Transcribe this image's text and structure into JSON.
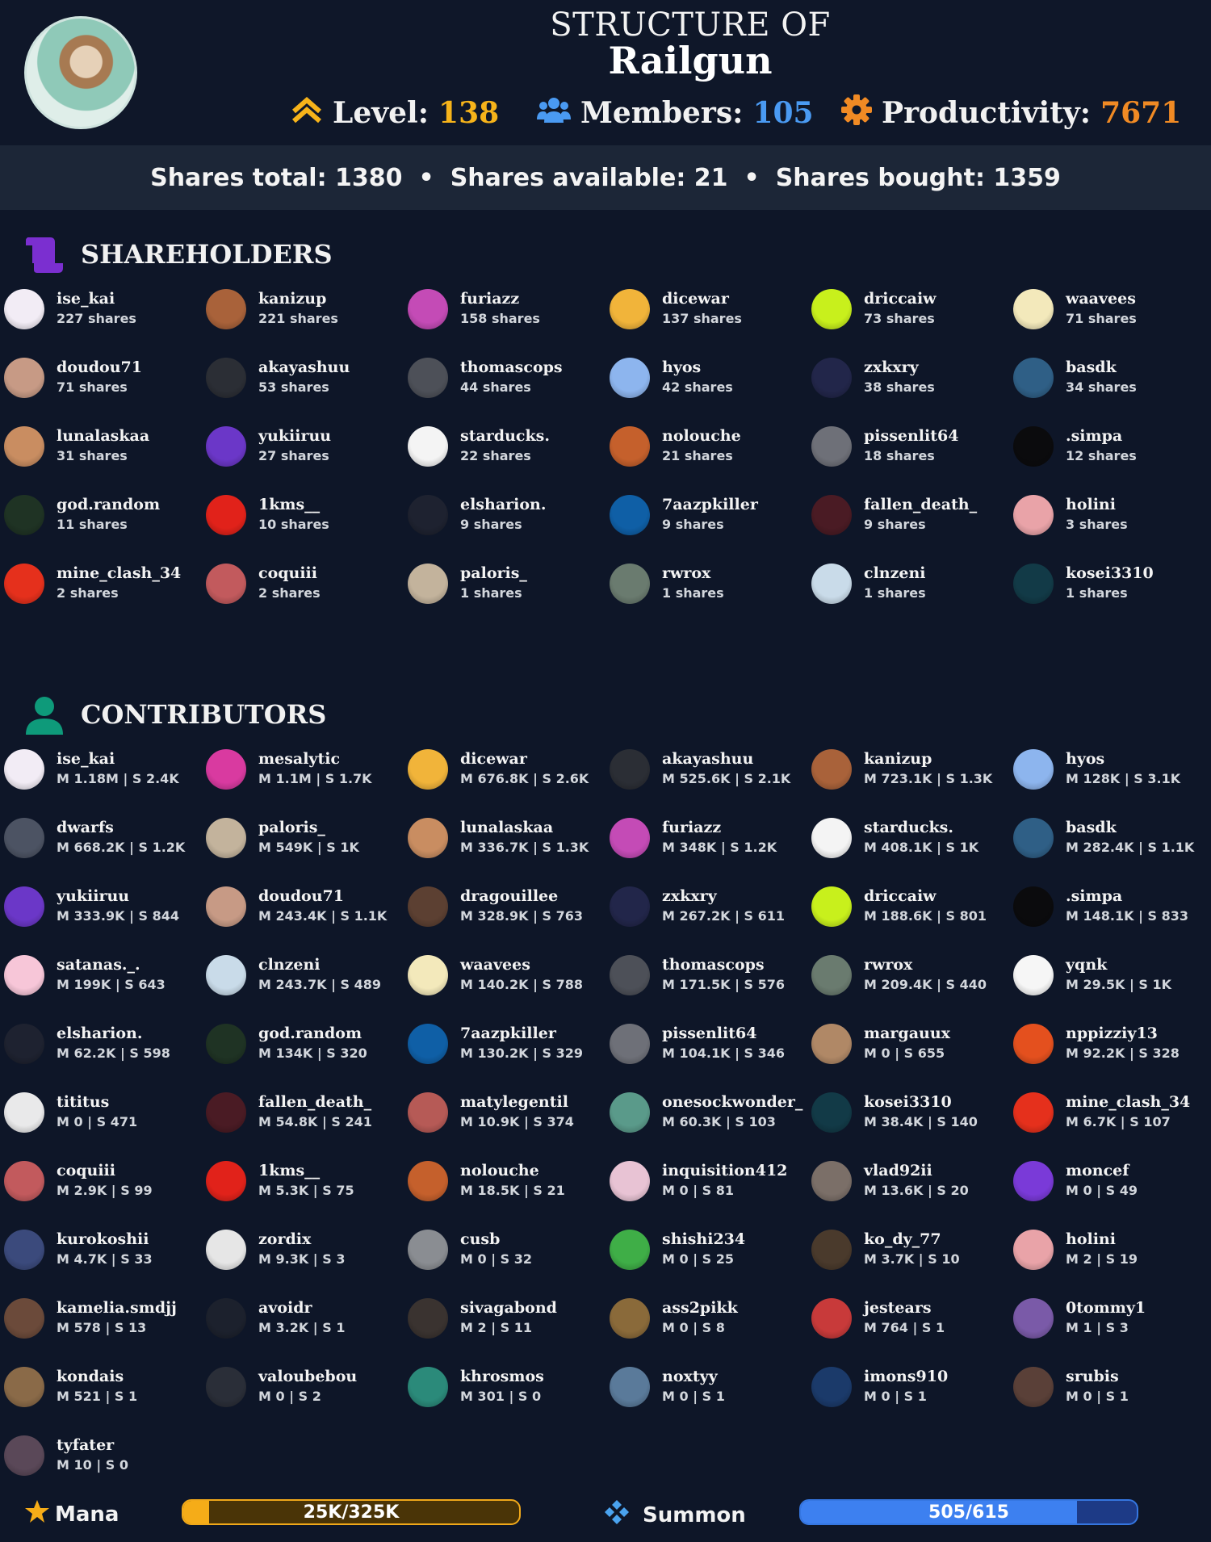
{
  "header": {
    "title_prefix": "STRUCTURE OF",
    "title_name": "Railgun",
    "level_label": "Level:",
    "level_value": "138",
    "members_label": "Members:",
    "members_value": "105",
    "productivity_label": "Productivity:",
    "productivity_value": "7671",
    "icons": {
      "level": "double-chevron-up-icon",
      "members": "users-icon",
      "productivity": "gear-icon"
    },
    "colors": {
      "level": "#f6b31a",
      "members": "#4a9af2",
      "productivity": "#f08a24"
    }
  },
  "shares_bar": {
    "total": "Shares total: 1380",
    "available": "Shares available: 21",
    "bought": "Shares bought: 1359",
    "separator": "•"
  },
  "shareholders": {
    "title": "SHAREHOLDERS",
    "icon": "scroll-icon",
    "icon_color": "#7b2fd0",
    "items": [
      {
        "name": "ise_kai",
        "sub": "227 shares",
        "color": "#f2ecf5"
      },
      {
        "name": "kanizup",
        "sub": "221 shares",
        "color": "#a9623a"
      },
      {
        "name": "furiazz",
        "sub": "158 shares",
        "color": "#c44bb6"
      },
      {
        "name": "dicewar",
        "sub": "137 shares",
        "color": "#f1b43a"
      },
      {
        "name": "driccaiw",
        "sub": "73 shares",
        "color": "#c8f01c"
      },
      {
        "name": "waavees",
        "sub": "71 shares",
        "color": "#f3e9bb"
      },
      {
        "name": "doudou71",
        "sub": "71 shares",
        "color": "#c79a85"
      },
      {
        "name": "akayashuu",
        "sub": "53 shares",
        "color": "#2b2e35"
      },
      {
        "name": "thomascops",
        "sub": "44 shares",
        "color": "#4d5058"
      },
      {
        "name": "hyos",
        "sub": "42 shares",
        "color": "#8db5ee"
      },
      {
        "name": "zxkxry",
        "sub": "38 shares",
        "color": "#22264a"
      },
      {
        "name": "basdk",
        "sub": "34 shares",
        "color": "#2f5f86"
      },
      {
        "name": "lunalaskaa",
        "sub": "31 shares",
        "color": "#c98d61"
      },
      {
        "name": "yukiiruu",
        "sub": "27 shares",
        "color": "#6b37c8"
      },
      {
        "name": "starducks.",
        "sub": "22 shares",
        "color": "#f4f4f4"
      },
      {
        "name": "nolouche",
        "sub": "21 shares",
        "color": "#c5602c"
      },
      {
        "name": "pissenlit64",
        "sub": "18 shares",
        "color": "#6e7078"
      },
      {
        "name": ".simpa",
        "sub": "12 shares",
        "color": "#0b0b0d"
      },
      {
        "name": "god.random",
        "sub": "11 shares",
        "color": "#1f3324"
      },
      {
        "name": "1kms__",
        "sub": "10 shares",
        "color": "#e1221a"
      },
      {
        "name": "elsharion.",
        "sub": "9 shares",
        "color": "#1e2230"
      },
      {
        "name": "7aazpkiller",
        "sub": "9 shares",
        "color": "#0f5fa6"
      },
      {
        "name": "fallen_death_",
        "sub": "9 shares",
        "color": "#4a1b24"
      },
      {
        "name": "holini",
        "sub": "3 shares",
        "color": "#e9a3a8"
      },
      {
        "name": "mine_clash_34",
        "sub": "2 shares",
        "color": "#e5301c"
      },
      {
        "name": "coquiii",
        "sub": "2 shares",
        "color": "#c25a5d"
      },
      {
        "name": "paloris_",
        "sub": "1 shares",
        "color": "#c3b39c"
      },
      {
        "name": "rwrox",
        "sub": "1 shares",
        "color": "#6a7b6f"
      },
      {
        "name": "clnzeni",
        "sub": "1 shares",
        "color": "#c9dbe9"
      },
      {
        "name": "kosei3310",
        "sub": "1 shares",
        "color": "#123a47"
      }
    ]
  },
  "contributors": {
    "title": "CONTRIBUTORS",
    "icon": "person-icon",
    "icon_color": "#0e9a7a",
    "items": [
      {
        "name": "ise_kai",
        "sub": "M 1.18M  |  S 2.4K",
        "color": "#f2ecf5"
      },
      {
        "name": "mesalytic",
        "sub": "M 1.1M  |  S 1.7K",
        "color": "#d93aa0"
      },
      {
        "name": "dicewar",
        "sub": "M 676.8K  |  S 2.6K",
        "color": "#f1b43a"
      },
      {
        "name": "akayashuu",
        "sub": "M 525.6K  |  S 2.1K",
        "color": "#2b2e35"
      },
      {
        "name": "kanizup",
        "sub": "M 723.1K  |  S 1.3K",
        "color": "#a9623a"
      },
      {
        "name": "hyos",
        "sub": "M 128K  |  S 3.1K",
        "color": "#8db5ee"
      },
      {
        "name": "dwarfs",
        "sub": "M 668.2K  |  S 1.2K",
        "color": "#4c5363"
      },
      {
        "name": "paloris_",
        "sub": "M 549K  |  S 1K",
        "color": "#c3b39c"
      },
      {
        "name": "lunalaskaa",
        "sub": "M 336.7K  |  S 1.3K",
        "color": "#c98d61"
      },
      {
        "name": "furiazz",
        "sub": "M 348K  |  S 1.2K",
        "color": "#c44bb6"
      },
      {
        "name": "starducks.",
        "sub": "M 408.1K  |  S 1K",
        "color": "#f4f4f4"
      },
      {
        "name": "basdk",
        "sub": "M 282.4K  |  S 1.1K",
        "color": "#2f5f86"
      },
      {
        "name": "yukiiruu",
        "sub": "M 333.9K  |  S 844",
        "color": "#6b37c8"
      },
      {
        "name": "doudou71",
        "sub": "M 243.4K  |  S 1.1K",
        "color": "#c79a85"
      },
      {
        "name": "dragouillee",
        "sub": "M 328.9K  |  S 763",
        "color": "#5c4032"
      },
      {
        "name": "zxkxry",
        "sub": "M 267.2K  |  S 611",
        "color": "#22264a"
      },
      {
        "name": "driccaiw",
        "sub": "M 188.6K  |  S 801",
        "color": "#c8f01c"
      },
      {
        "name": ".simpa",
        "sub": "M 148.1K  |  S 833",
        "color": "#0b0b0d"
      },
      {
        "name": "satanas._.",
        "sub": "M 199K  |  S 643",
        "color": "#f7c6d8"
      },
      {
        "name": "clnzeni",
        "sub": "M 243.7K  |  S 489",
        "color": "#c9dbe9"
      },
      {
        "name": "waavees",
        "sub": "M 140.2K  |  S 788",
        "color": "#f3e9bb"
      },
      {
        "name": "thomascops",
        "sub": "M 171.5K  |  S 576",
        "color": "#4d5058"
      },
      {
        "name": "rwrox",
        "sub": "M 209.4K  |  S 440",
        "color": "#6a7b6f"
      },
      {
        "name": "yqnk",
        "sub": "M 29.5K  |  S 1K",
        "color": "#f6f6f6"
      },
      {
        "name": "elsharion.",
        "sub": "M 62.2K  |  S 598",
        "color": "#1e2230"
      },
      {
        "name": "god.random",
        "sub": "M 134K  |  S 320",
        "color": "#1f3324"
      },
      {
        "name": "7aazpkiller",
        "sub": "M 130.2K  |  S 329",
        "color": "#0f5fa6"
      },
      {
        "name": "pissenlit64",
        "sub": "M 104.1K  |  S 346",
        "color": "#6e7078"
      },
      {
        "name": "margauux",
        "sub": "M 0  |  S 655",
        "color": "#b08866"
      },
      {
        "name": "nppizziy13",
        "sub": "M 92.2K  |  S 328",
        "color": "#e4501e"
      },
      {
        "name": "tititus",
        "sub": "M 0  |  S 471",
        "color": "#e9e9ea"
      },
      {
        "name": "fallen_death_",
        "sub": "M 54.8K  |  S 241",
        "color": "#4a1b24"
      },
      {
        "name": "matylegentil",
        "sub": "M 10.9K  |  S 374",
        "color": "#b65a56"
      },
      {
        "name": "onesockwonder_",
        "sub": "M 60.3K  |  S 103",
        "color": "#5a9a8a"
      },
      {
        "name": "kosei3310",
        "sub": "M 38.4K  |  S 140",
        "color": "#123a47"
      },
      {
        "name": "mine_clash_34",
        "sub": "M 6.7K  |  S 107",
        "color": "#e5301c"
      },
      {
        "name": "coquiii",
        "sub": "M 2.9K  |  S 99",
        "color": "#c25a5d"
      },
      {
        "name": "1kms__",
        "sub": "M 5.3K  |  S 75",
        "color": "#e1221a"
      },
      {
        "name": "nolouche",
        "sub": "M 18.5K  |  S 21",
        "color": "#c5602c"
      },
      {
        "name": "inquisition412",
        "sub": "M 0  |  S 81",
        "color": "#e8c3d4"
      },
      {
        "name": "vlad92ii",
        "sub": "M 13.6K  |  S 20",
        "color": "#7b6f68"
      },
      {
        "name": "moncef",
        "sub": "M 0  |  S 49",
        "color": "#7a3ad8"
      },
      {
        "name": "kurokoshii",
        "sub": "M 4.7K  |  S 33",
        "color": "#3b4a7c"
      },
      {
        "name": "zordix",
        "sub": "M 9.3K  |  S 3",
        "color": "#e6e6e6"
      },
      {
        "name": "cusb",
        "sub": "M 0  |  S 32",
        "color": "#8a8d92"
      },
      {
        "name": "shishi234",
        "sub": "M 0  |  S 25",
        "color": "#3fae47"
      },
      {
        "name": "ko_dy_77",
        "sub": "M 3.7K  |  S 10",
        "color": "#4a3a2c"
      },
      {
        "name": "holini",
        "sub": "M 2  |  S 19",
        "color": "#e9a3a8"
      },
      {
        "name": "kamelia.smdjj",
        "sub": "M 578  |  S 13",
        "color": "#6b4a3a"
      },
      {
        "name": "avoidr",
        "sub": "M 3.2K  |  S 1",
        "color": "#1c212d"
      },
      {
        "name": "sivagabond",
        "sub": "M 2  |  S 11",
        "color": "#3a3330"
      },
      {
        "name": "ass2pikk",
        "sub": "M 0  |  S 8",
        "color": "#8a6a3a"
      },
      {
        "name": "jestears",
        "sub": "M 764  |  S 1",
        "color": "#c83a3a"
      },
      {
        "name": "0tommy1",
        "sub": "M 1  |  S 3",
        "color": "#7a5aa8"
      },
      {
        "name": "kondais",
        "sub": "M 521  |  S 1",
        "color": "#8a6a48"
      },
      {
        "name": "valoubebou",
        "sub": "M 0  |  S 2",
        "color": "#2a2e38"
      },
      {
        "name": "khrosmos",
        "sub": "M 301  |  S 0",
        "color": "#2b8a7a"
      },
      {
        "name": "noxtyy",
        "sub": "M 0  |  S 1",
        "color": "#5a7a9a"
      },
      {
        "name": "imons910",
        "sub": "M 0  |  S 1",
        "color": "#1b3a6a"
      },
      {
        "name": "srubis",
        "sub": "M 0  |  S 1",
        "color": "#5a4038"
      },
      {
        "name": "tyfater",
        "sub": "M 10  |  S 0",
        "color": "#5a4858"
      }
    ]
  },
  "footer": {
    "mana_label": "Mana",
    "mana_icon": "star-icon",
    "mana_text": "25K/325K",
    "mana_fraction": 0.077,
    "summon_label": "Summon",
    "summon_icon": "diamond-cluster-icon",
    "summon_text": "505/615",
    "summon_fraction": 0.821
  }
}
